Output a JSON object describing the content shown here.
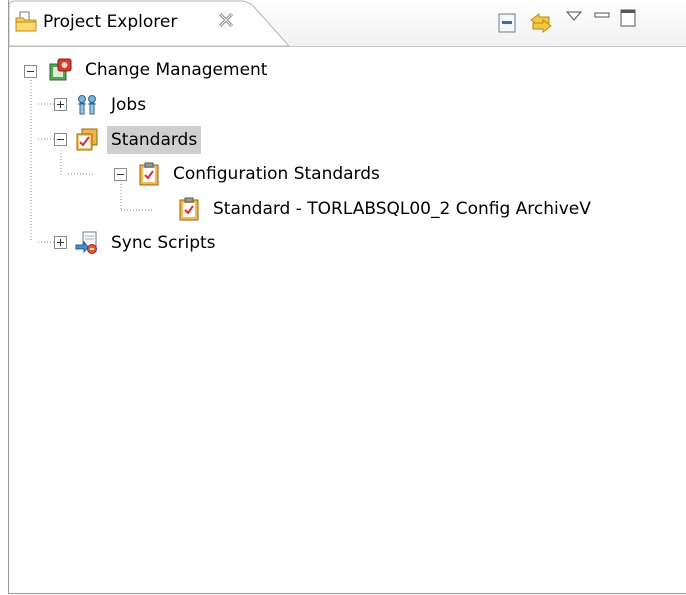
{
  "tab": {
    "title": "Project Explorer"
  },
  "tree": {
    "root": "Change Management",
    "jobs": "Jobs",
    "standards": "Standards",
    "config_standards": "Configuration Standards",
    "standard_item": "Standard - TORLABSQL00_2 Config ArchiveV",
    "sync_scripts": "Sync Scripts"
  }
}
